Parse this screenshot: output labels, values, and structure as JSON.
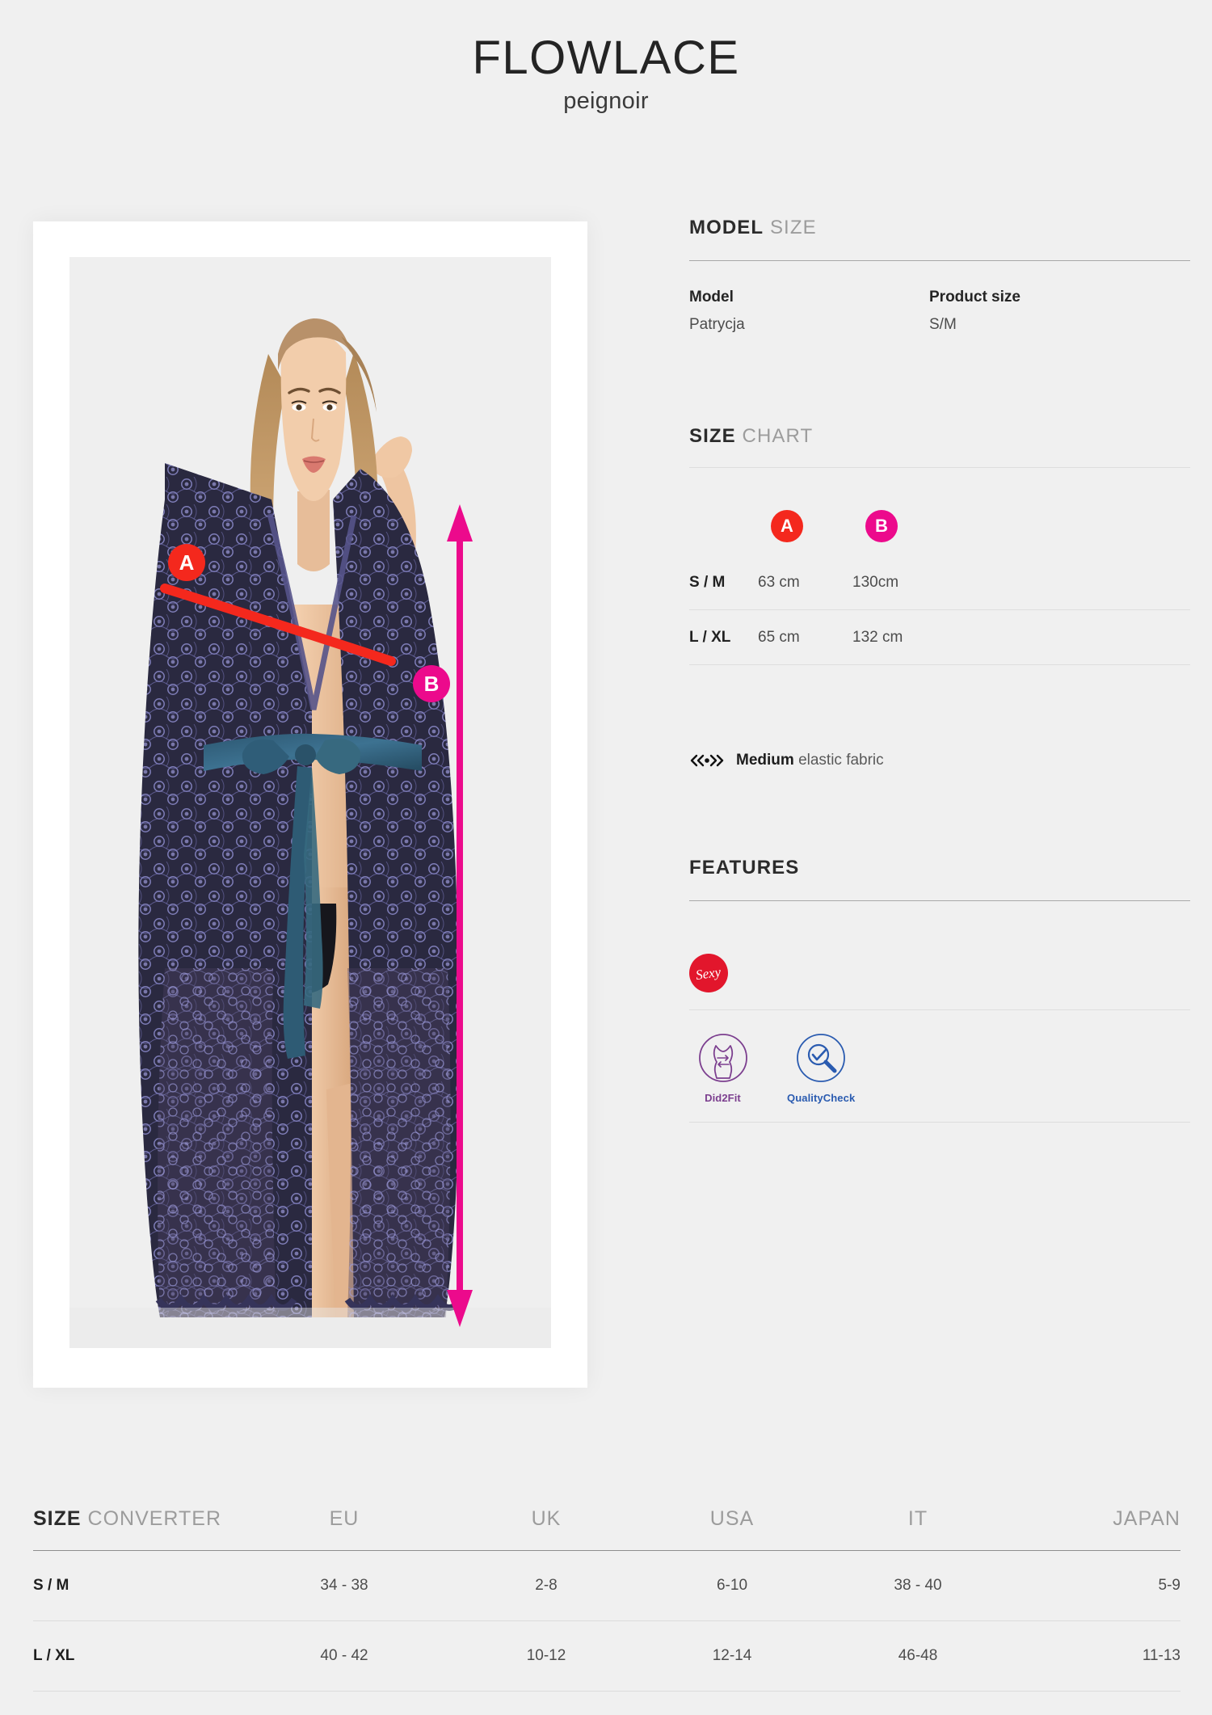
{
  "header": {
    "title": "FLOWLACE",
    "subtitle": "peignoir"
  },
  "photo": {
    "marker_a": "A",
    "marker_b": "B",
    "marker_a_color": "#f4281d",
    "marker_b_color": "#ec0a8c"
  },
  "model_size": {
    "heading_bold": "MODEL",
    "heading_light": "SIZE",
    "model_label": "Model",
    "model_value": "Patrycja",
    "product_size_label": "Product size",
    "product_size_value": "S/M"
  },
  "size_chart": {
    "heading_bold": "SIZE",
    "heading_light": "CHART",
    "badge_a": "A",
    "badge_b": "B",
    "rows": [
      {
        "size": "S / M",
        "a": "63 cm",
        "b": "130cm"
      },
      {
        "size": "L / XL",
        "a": "65 cm",
        "b": "132 cm"
      }
    ]
  },
  "elasticity": {
    "icon": "elasticity-medium-icon",
    "glyph": "⟨⟨•⟩⟩",
    "level": "Medium",
    "text": "elastic fabric"
  },
  "features": {
    "heading": "FEATURES",
    "sexy_badge": "Sexy",
    "sexy_badge_color": "#e2162c",
    "items": [
      {
        "name": "Did2Fit",
        "color": "#7c3f8f",
        "icon": "dress-fit-icon"
      },
      {
        "name": "QualityCheck",
        "color": "#2a5bb0",
        "icon": "magnifier-check-icon"
      }
    ]
  },
  "size_converter": {
    "heading_bold": "SIZE",
    "heading_light": "CONVERTER",
    "columns": [
      "EU",
      "UK",
      "USA",
      "IT",
      "JAPAN"
    ],
    "rows": [
      {
        "size": "S / M",
        "eu": "34 - 38",
        "uk": "2-8",
        "usa": "6-10",
        "it": "38 - 40",
        "japan": "5-9"
      },
      {
        "size": "L / XL",
        "eu": "40 - 42",
        "uk": "10-12",
        "usa": "12-14",
        "it": "46-48",
        "japan": "11-13"
      }
    ]
  }
}
